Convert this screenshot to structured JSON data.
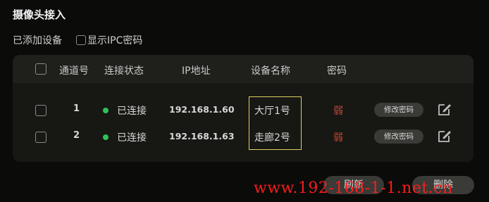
{
  "page": {
    "title": "摄像头接入"
  },
  "toolbar": {
    "added_label": "已添加设备",
    "show_ipc_label": "显示IPC密码",
    "show_ipc_checked": false
  },
  "table": {
    "headers": {
      "channel": "通道号",
      "status": "连接状态",
      "ip": "IP地址",
      "name": "设备名称",
      "password": "密码"
    },
    "rows": [
      {
        "channel": "1",
        "status": "已连接",
        "ip": "192.168.1.60",
        "name": "大厅1号",
        "password": "弱",
        "change_label": "修改密码"
      },
      {
        "channel": "2",
        "status": "已连接",
        "ip": "192.168.1.63",
        "name": "走廊2号",
        "password": "弱",
        "change_label": "修改密码"
      }
    ]
  },
  "actions": {
    "refresh": "刷新",
    "delete": "删除"
  },
  "watermark": "www.192-168-1-1.net.cn",
  "colors": {
    "connected": "#2ec35a",
    "weak_password": "#c84a36",
    "highlight": "#e0d060"
  },
  "icons": {
    "edit": "pencil-square-icon",
    "status": "green-dot-icon"
  }
}
